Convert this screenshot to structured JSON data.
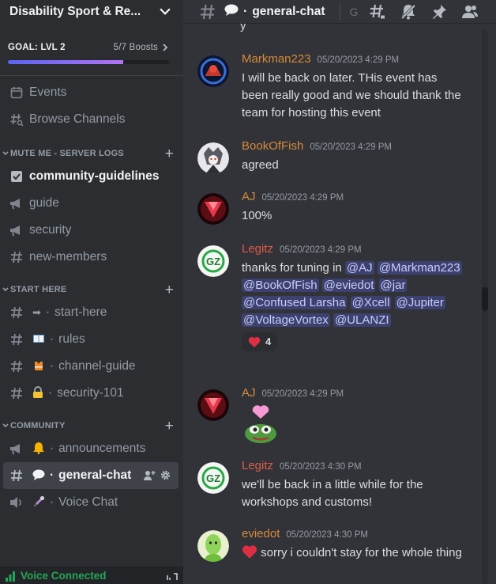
{
  "server": {
    "name": "Disability Sport & Re..."
  },
  "goal": {
    "label": "GOAL: LVL 2",
    "boosts": "5/7 Boosts",
    "fraction": 0.714
  },
  "nav": {
    "events": "Events",
    "browse": "Browse Channels"
  },
  "categories": [
    {
      "name": "MUTE ME - SERVER LOGS",
      "channels": [
        "community-guidelines",
        "guide",
        "security",
        "new-members"
      ]
    },
    {
      "name": "START HERE",
      "channels": [
        "start-here",
        "rules",
        "channel-guide",
        "security-101"
      ]
    },
    {
      "name": "COMMUNITY",
      "channels": [
        "announcements",
        "general-chat",
        "Voice Chat"
      ]
    }
  ],
  "voice": {
    "status": "Voice Connected"
  },
  "header": {
    "channel": "general-chat",
    "search_hint": "G"
  },
  "partial_top": "y",
  "messages": [
    {
      "author": "Markman223",
      "color": "#d68a3a",
      "time": "05/20/2023 4:29 PM",
      "text": "I will be back on later. THis event has been really good and we should thank the team for hosting this event"
    },
    {
      "author": "BookOfFish",
      "color": "#d68a3a",
      "time": "05/20/2023 4:29 PM",
      "text": "agreed"
    },
    {
      "author": "AJ",
      "color": "#d68a3a",
      "time": "05/20/2023 4:29 PM",
      "text": "100%"
    },
    {
      "author": "Legitz",
      "color": "#e05a4a",
      "time": "05/20/2023 4:29 PM",
      "text_prefix": "thanks for tuning in",
      "mentions": [
        "@AJ",
        "@Markman223",
        "@BookOfFish",
        "@eviedot",
        "@jar",
        "@Confused Larsha",
        "@Xcell",
        "@Jupiter",
        "@VoltageVortex",
        "@ULANZI"
      ],
      "reaction_count": "4"
    },
    {
      "author": "AJ",
      "color": "#d68a3a",
      "time": "05/20/2023 4:29 PM",
      "text": ""
    },
    {
      "author": "Legitz",
      "color": "#e05a4a",
      "time": "05/20/2023 4:30 PM",
      "text": "we'll be back in a little while for the workshops and customs!"
    },
    {
      "author": "eviedot",
      "color": "#d68a3a",
      "time": "05/20/2023 4:30 PM",
      "text": "sorry i couldn't stay for the whole thing"
    }
  ],
  "icons": {
    "events": "calendar-icon",
    "browse": "browse-channels-icon",
    "rules": "book-emoji",
    "channel_guide": "life-vest-emoji",
    "security101": "padlock-emoji",
    "announcements": "bell-emoji",
    "general": "speech-bubble-emoji",
    "voice": "microphone-emoji"
  }
}
